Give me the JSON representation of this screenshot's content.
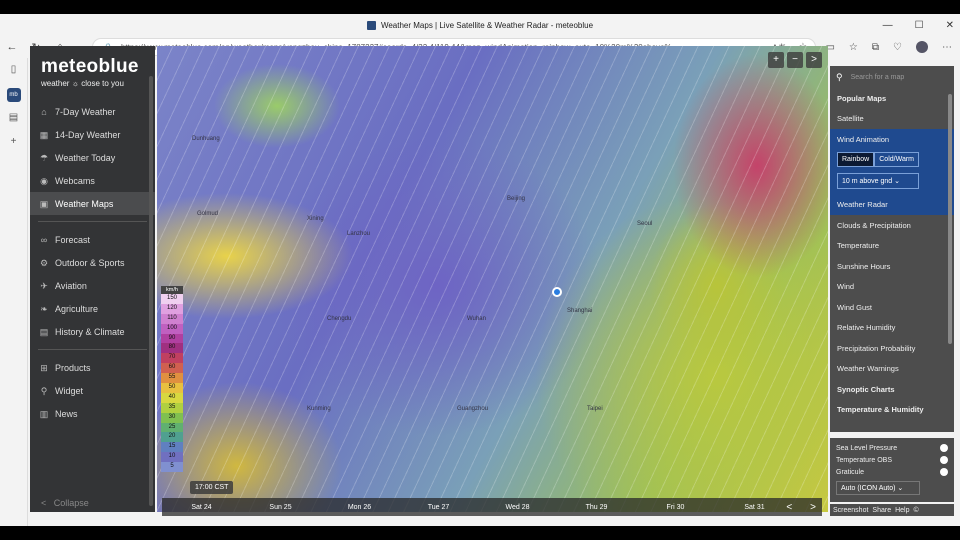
{
  "browser": {
    "title": "Weather Maps | Live Satellite & Weather Radar - meteoblue",
    "url": "https://www.meteoblue.com/en/weather/maps/yangzhou_china_1787227#coords=4/32.4/119.44&map=windAnimation~rainbow~auto~10%20m%20above%..."
  },
  "sidebar": {
    "logo": "meteoblue",
    "tagline": "weather ☼ close to you",
    "items": [
      {
        "label": "7-Day Weather",
        "icon": "home-icon"
      },
      {
        "label": "14-Day Weather",
        "icon": "calendar-icon"
      },
      {
        "label": "Weather Today",
        "icon": "weather-today-icon"
      },
      {
        "label": "Webcams",
        "icon": "webcam-icon"
      },
      {
        "label": "Weather Maps",
        "icon": "map-icon",
        "active": true
      }
    ],
    "items2": [
      {
        "label": "Forecast",
        "icon": "glasses-icon"
      },
      {
        "label": "Outdoor & Sports",
        "icon": "bike-icon"
      },
      {
        "label": "Aviation",
        "icon": "plane-icon"
      },
      {
        "label": "Agriculture",
        "icon": "leaf-icon"
      },
      {
        "label": "History & Climate",
        "icon": "history-icon"
      }
    ],
    "items3": [
      {
        "label": "Products",
        "icon": "cart-icon"
      },
      {
        "label": "Widget",
        "icon": "widget-icon"
      },
      {
        "label": "News",
        "icon": "news-icon"
      }
    ],
    "collapse": "Collapse"
  },
  "map": {
    "legend_unit": "km/h",
    "legend_values": [
      "150",
      "120",
      "110",
      "100",
      "90",
      "80",
      "70",
      "60",
      "55",
      "50",
      "40",
      "35",
      "30",
      "25",
      "20",
      "15",
      "10",
      "5"
    ],
    "legend_colors": [
      "#f0d0f0",
      "#e0a0e0",
      "#d080d0",
      "#c060c0",
      "#b040a0",
      "#a03080",
      "#c04060",
      "#d06050",
      "#e09040",
      "#e8c040",
      "#d8d840",
      "#b0d040",
      "#80c050",
      "#60b070",
      "#50a090",
      "#6080c0",
      "#7070c0",
      "#8090d0"
    ],
    "time_badge": "17:00 CST",
    "cities": [
      "Dunhuang",
      "Golmud",
      "Xining",
      "Lanzhou",
      "Chengdu",
      "Kunming",
      "Beijing",
      "Shanghai",
      "Wuhan",
      "Guangzhou",
      "Seoul",
      "Taipei"
    ],
    "zoom_in": "+",
    "zoom_out": "−",
    "toggle_panel": ">"
  },
  "timeline": {
    "days": [
      "Sat 24",
      "Sun 25",
      "Mon 26",
      "Tue 27",
      "Wed 28",
      "Thu 29",
      "Fri 30",
      "Sat 31"
    ],
    "prev": "<",
    "next": ">"
  },
  "panel": {
    "search_placeholder": "Search for a map",
    "section_popular": "Popular Maps",
    "satellite": "Satellite",
    "wind_animation": "Wind Animation",
    "seg_rainbow": "Rainbow",
    "seg_coldwarm": "Cold/Warm",
    "level_select": "10 m above gnd",
    "items": [
      "Weather Radar",
      "Clouds & Precipitation",
      "Temperature",
      "Sunshine Hours",
      "Wind",
      "Wind Gust",
      "Relative Humidity",
      "Precipitation Probability",
      "Weather Warnings"
    ],
    "section_synoptic": "Synoptic Charts",
    "section_temp": "Temperature & Humidity"
  },
  "overlays": {
    "items": [
      "Sea Level Pressure",
      "Temperature OBS",
      "Graticule"
    ],
    "model_select": "Auto (ICON Auto)"
  },
  "footer": {
    "screenshot": "Screenshot",
    "share": "Share",
    "help": "Help",
    "copyright": "©"
  }
}
